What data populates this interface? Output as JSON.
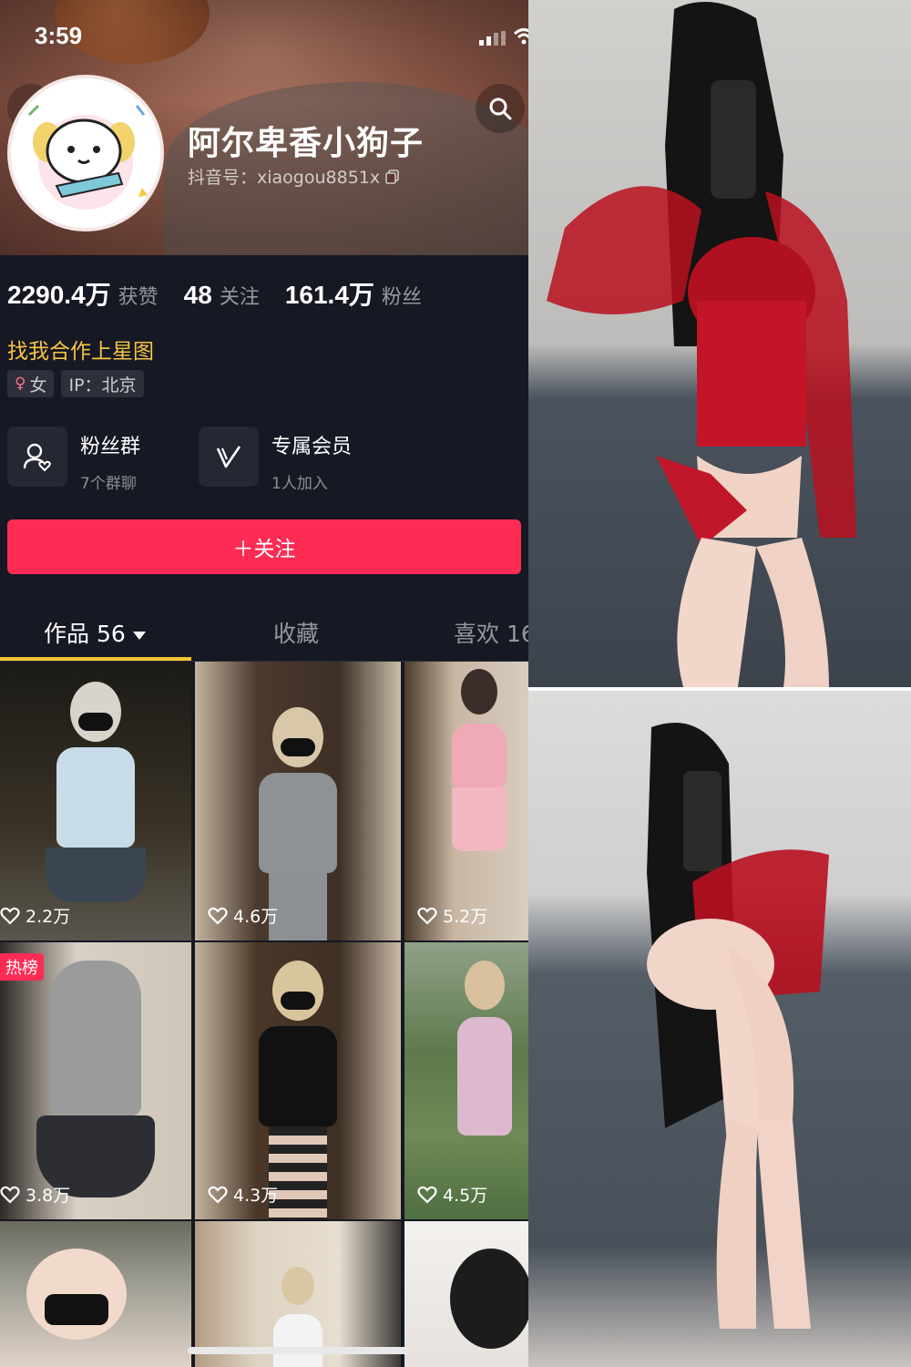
{
  "status_bar": {
    "time": "3:59"
  },
  "profile": {
    "nickname": "阿尔卑香小狗子",
    "douyin_id": "抖音号：xiaogou8851x",
    "stats": [
      {
        "value": "2290.4万",
        "label": "获赞"
      },
      {
        "value": "48",
        "label": "关注"
      },
      {
        "value": "161.4万",
        "label": "粉丝"
      }
    ],
    "cooperation_link": "找我合作上星图",
    "tags": {
      "gender": "女",
      "ip": "IP：北京"
    },
    "features": [
      {
        "title": "粉丝群",
        "subtitle": "7个群聊",
        "icon": "fans-group-icon"
      },
      {
        "title": "专属会员",
        "subtitle": "1人加入",
        "icon": "membership-icon"
      }
    ],
    "follow_button": "＋关注"
  },
  "tabs": {
    "works": "作品 56",
    "favorites": "收藏",
    "likes": "喜欢 16"
  },
  "videos": [
    {
      "likes": "2.2万"
    },
    {
      "likes": "4.6万"
    },
    {
      "likes": "5.2万"
    },
    {
      "likes": "3.8万",
      "badge": "热榜"
    },
    {
      "likes": "4.3万"
    },
    {
      "likes": "4.5万"
    },
    {
      "likes": ""
    },
    {
      "likes": ""
    },
    {
      "likes": ""
    }
  ],
  "colors": {
    "background": "#161823",
    "follow_button": "#fe2c55",
    "cooperation_text": "#f6c545",
    "tab_underline": "#f7c331"
  }
}
